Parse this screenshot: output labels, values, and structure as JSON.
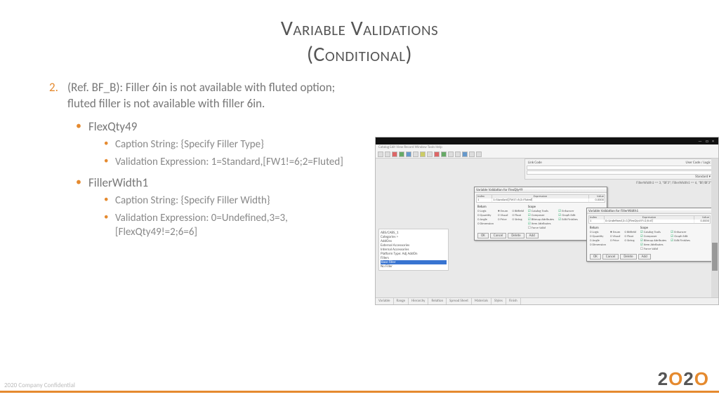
{
  "title": {
    "line1": "Variable Validations",
    "line2": "(Conditional)"
  },
  "list": {
    "num": "2.",
    "p": "(Ref. BF_B): Filler 6in is not available with fluted option; fluted filler is not available with filler 6in.",
    "i1": {
      "name": "FlexQty49",
      "cap": "Caption String: {Specify Filler Type}",
      "val": "Validation Expression: 1=Standard,[FW1!=6;2=Fluted]"
    },
    "i2": {
      "name": "FillerWidth1",
      "cap": "Caption String: {Specify Filler Width}",
      "val": "Validation Expression: 0=Undefined,3=3,[FlexQty49!=2;6=6]"
    }
  },
  "app": {
    "menu": "Catalog  Edit  View  Record  Window  Tools  Help",
    "winbtns": "—  □  ×",
    "rp": {
      "l1": "Link Code",
      "l2": "User Code / Logic",
      "sel": "Standard ▾",
      "bf": "Base Filler"
    },
    "tree": [
      "ABS/CABS_1",
      "Categories >",
      "AddOns",
      "External Accessories",
      "Internal Accessories",
      "Platform Type: Adj AddOn",
      "Fillers"
    ],
    "tree_hl": "Base Filler",
    "tree_last": "No Filler",
    "tabs": [
      "Variable",
      "Range",
      "Hierarchy",
      "Relation",
      "Spread Sheet",
      "Materials",
      "Styles",
      "Finish"
    ],
    "d1": {
      "title": "Variable Validation for FlexQty49",
      "gh": [
        "Index",
        "Expression",
        "Value"
      ],
      "gr": [
        "1",
        "1=Standard,[FW1!=6;2=Fluted]",
        "0.0000"
      ],
      "retcol": "Return",
      "ret": [
        "Logic",
        "Quantity",
        "Angle",
        "Dimension"
      ],
      "retcol2": [
        "Enum",
        "Visual",
        "Price"
      ],
      "retcol3": [
        "Bitfield",
        "Float",
        "String"
      ],
      "scopecol": "Scope",
      "scope": [
        "Catalog Tools",
        "Composer",
        "Bitmap Attributes",
        "Item Attributes",
        "Force Valid"
      ],
      "scope2": [
        "Enhancer",
        "Graph Edit",
        "Edit Finishes"
      ],
      "btns": [
        "OK",
        "Cancel",
        "Delete",
        "Add"
      ]
    },
    "d2": {
      "title": "Variable Validation for FillerWidth1",
      "gh": [
        "Index",
        "Expression",
        "Value"
      ],
      "gr": [
        "1",
        "0=Undefined,3=3,[FlexQty49!=2;6=6]",
        "0.0000"
      ],
      "btns": [
        "OK",
        "Cancel",
        "Delete",
        "Add"
      ]
    },
    "crumb": "FillerWidth1 == 3, \"BF3\"; FillerWidth1 == 6, \"BF/BF3\""
  },
  "footer": {
    "conf": "2020 Company Confidential",
    "logo_a": "2",
    "logo_b": "O",
    "logo_c": "2",
    "logo_d": "O"
  }
}
